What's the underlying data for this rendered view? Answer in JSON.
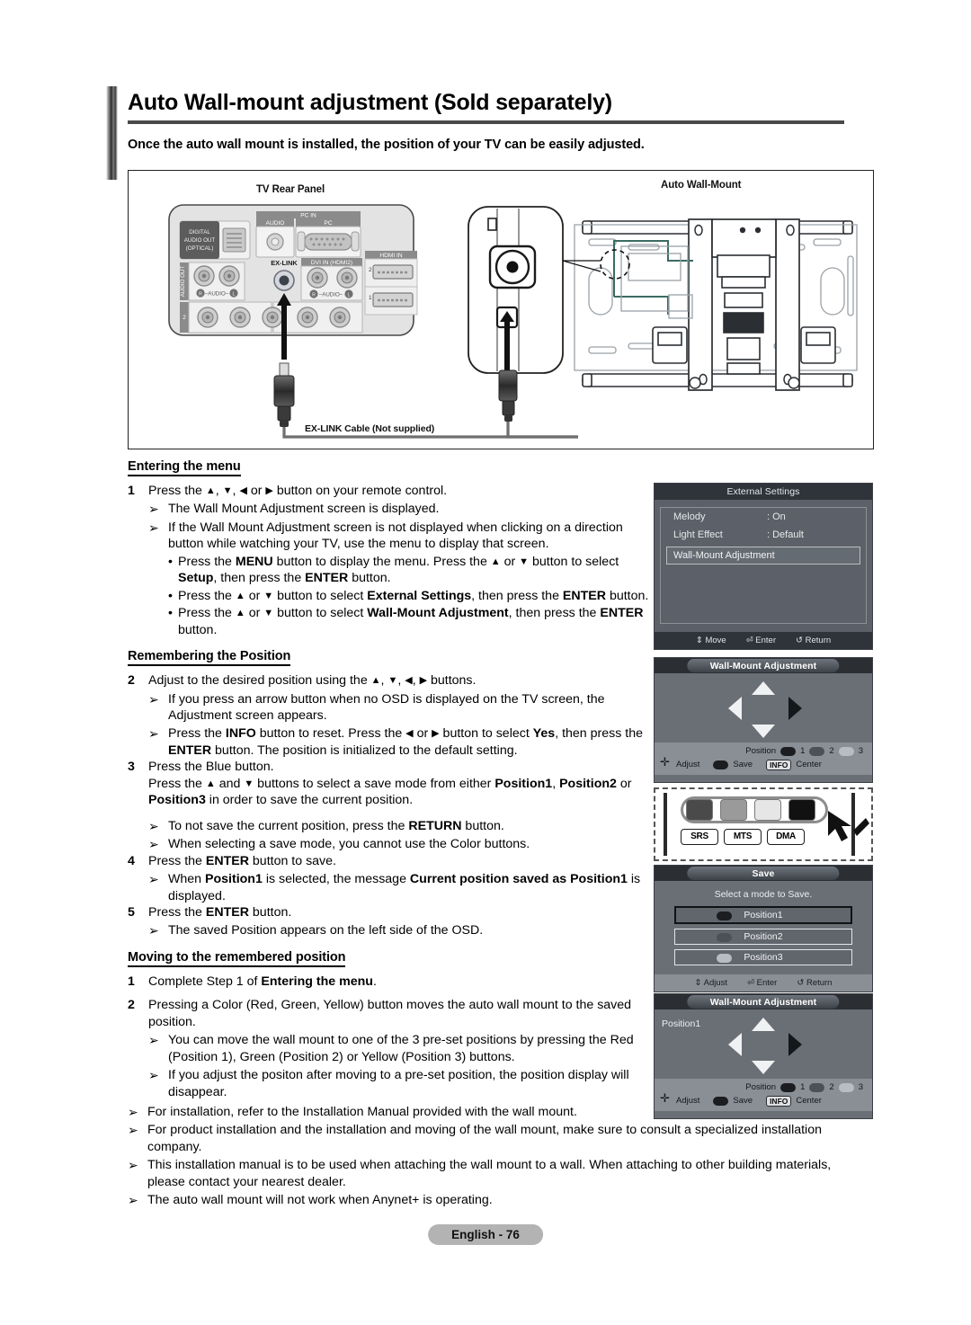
{
  "header": {
    "title": "Auto Wall-mount adjustment (Sold separately)",
    "subtitle": "Once the auto wall mount is installed, the position of your TV can be easily adjusted."
  },
  "illustration": {
    "tv_rear_label": "TV Rear Panel",
    "auto_wall_mount_label": "Auto Wall-Mount",
    "cable_label": "EX-LINK Cable (Not supplied)",
    "ports": {
      "digital_audio_out": "DIGITAL AUDIO OUT (OPTICAL)",
      "pc_in": "PC IN",
      "pc_in_audio": "AUDIO",
      "pc_in_pc": "PC",
      "hdmi_in": "HDMI IN",
      "hdmi_2": "2",
      "hdmi_1": "1",
      "ex_link": "EX-LINK",
      "dvi_in": "DVI IN (HDMI2)",
      "audio_out": "AUDIO OUT",
      "audio_rl": "R-AUDIO-L",
      "comp_2": "2"
    }
  },
  "sections": {
    "entering": {
      "heading": "Entering the menu",
      "step1_num": "1",
      "step1_pre": "Press the ",
      "step1_post": " button on your remote control.",
      "b1": "The Wall Mount Adjustment screen is displayed.",
      "b2": "If the Wall Mount Adjustment screen is not displayed when clicking on a direction button while watching your TV, use the menu to display that screen.",
      "d1_a": "Press the ",
      "d1_menu": "MENU",
      "d1_b": " button to display the menu. Press the ",
      "d1_c": " button to select ",
      "d1_setup": "Setup",
      "d1_d": ", then press the ",
      "d1_enter": "ENTER",
      "d1_e": " button.",
      "d2_a": "Press the ",
      "d2_b": " button to select ",
      "d2_ext": "External Settings",
      "d2_c": ", then press the ",
      "d2_enter": "ENTER",
      "d2_d": " button.",
      "d3_a": "Press the ",
      "d3_b": " button to select ",
      "d3_wma": "Wall-Mount Adjustment",
      "d3_c": ", then press the ",
      "d3_enter": "ENTER",
      "d3_d": " button."
    },
    "remembering": {
      "heading": "Remembering the Position",
      "step2_num": "2",
      "step2_pre": "Adjust to the desired position using the ",
      "step2_post": " buttons.",
      "b1": "If you press an arrow button when no OSD is displayed on the TV screen, the Adjustment screen appears.",
      "b2_a": "Press the ",
      "b2_info": "INFO",
      "b2_b": " button to reset. Press the ",
      "b2_c": " button to select ",
      "b2_yes": "Yes",
      "b2_d": ", then press the ",
      "b2_enter": "ENTER",
      "b2_e": " button. The position is initialized to the default setting.",
      "step3_num": "3",
      "step3_l1": "Press the Blue button.",
      "step3_l2_a": "Press the ",
      "step3_l2_b": " buttons to select a save mode from either ",
      "step3_p1": "Position1",
      "step3_l2_c": ", ",
      "step3_p2": "Position2",
      "step3_l2_d": " or ",
      "step3_p3": "Position3",
      "step3_l2_e": " in order to save the current position.",
      "b3_a": "To not save the current position, press the ",
      "b3_return": "RETURN",
      "b3_b": " button.",
      "b4": "When selecting a save mode, you cannot use the Color buttons.",
      "step4_num": "4",
      "step4_a": "Press the ",
      "step4_enter": "ENTER",
      "step4_b": " button to save.",
      "b5_a": "When ",
      "b5_p1": "Position1",
      "b5_b": " is selected, the message ",
      "b5_msg": "Current position saved as Position1",
      "b5_c": " is displayed.",
      "step5_num": "5",
      "step5_a": "Press the ",
      "step5_enter": "ENTER",
      "step5_b": " button.",
      "b6": "The saved Position appears on the left side of the OSD."
    },
    "moving": {
      "heading": "Moving to the remembered position",
      "step1_num": "1",
      "step1_a": "Complete Step 1 of ",
      "step1_b": "Entering the menu",
      "step1_c": ".",
      "step2_num": "2",
      "step2": "Pressing a Color (Red, Green, Yellow) button moves the auto wall mount to the saved position.",
      "b1": "You can move the wall mount to one of the 3 pre-set positions by pressing the Red (Position 1), Green (Position 2) or Yellow (Position 3) buttons.",
      "b2": "If you adjust the positon after moving to a pre-set position, the position display will disappear."
    },
    "notes": [
      "For installation, refer to the Installation Manual provided with the wall mount.",
      "For product installation and the installation and moving of the wall mount, make sure to consult a specialized installation company.",
      "This installation manual is to be used when attaching the wall mount to a wall. When attaching to other building materials, please contact your nearest dealer.",
      "The auto wall mount will not work when Anynet+ is operating."
    ]
  },
  "osd": {
    "external_settings": {
      "title": "External Settings",
      "rows": [
        {
          "key": "Melody",
          "value": ": On"
        },
        {
          "key": "Light Effect",
          "value": ": Default"
        }
      ],
      "highlighted": "Wall-Mount Adjustment",
      "footer": [
        "Move",
        "Enter",
        "Return"
      ],
      "footer_icons": [
        "updown-icon",
        "enter-icon",
        "return-icon"
      ]
    },
    "wall_mount_adjustment": {
      "title": "Wall-Mount Adjustment",
      "position_label": "Position",
      "pos1": "1",
      "pos2": "2",
      "pos3": "3",
      "adjust": "Adjust",
      "save": "Save",
      "info": "INFO",
      "center": "Center"
    },
    "wall_mount_adjustment_saved": {
      "title": "Wall-Mount Adjustment",
      "current_position": "Position1",
      "position_label": "Position",
      "pos1": "1",
      "pos2": "2",
      "pos3": "3",
      "adjust": "Adjust",
      "save": "Save",
      "info": "INFO",
      "center": "Center"
    },
    "save_panel": {
      "title": "Save",
      "prompt": "Select a mode to Save.",
      "options": [
        "Position1",
        "Position2",
        "Position3"
      ],
      "footer": [
        "Adjust",
        "Enter",
        "Return"
      ]
    }
  },
  "remote": {
    "buttons": [
      "SRS",
      "MTS",
      "DMA"
    ],
    "color_keys": [
      "red-key",
      "green-key",
      "yellow-key",
      "blue-key"
    ]
  },
  "footer": {
    "page_label": "English - 76"
  },
  "colors": {
    "rule": "#4a4a4a",
    "osd_body": "#5c6169",
    "osd_bar": "#2f343a",
    "osd_bottom": "#8a8f96",
    "footer_pill": "#b3b3b3"
  }
}
